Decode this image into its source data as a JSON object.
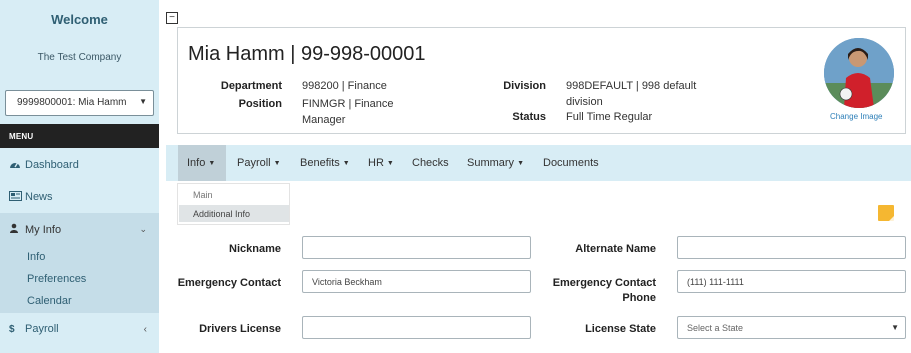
{
  "sidebar": {
    "welcome": "Welcome",
    "company": "The Test Company",
    "employee_select": "9999800001: Mia Hamm",
    "menu_heading": "MENU",
    "nav": {
      "dashboard": "Dashboard",
      "news": "News",
      "my_info": "My Info",
      "payroll": "Payroll"
    },
    "my_info_sub": [
      "Info",
      "Preferences",
      "Calendar"
    ]
  },
  "header": {
    "collapse_symbol": "−",
    "employee_title": "Mia Hamm | 99-998-00001",
    "department_label": "Department",
    "department_value": "998200 | Finance",
    "position_label": "Position",
    "position_value": "FINMGR | Finance Manager",
    "division_label": "Division",
    "division_value": "998DEFAULT | 998 default division",
    "status_label": "Status",
    "status_value": "Full Time Regular",
    "change_image": "Change Image"
  },
  "tabs": [
    "Info",
    "Payroll",
    "Benefits",
    "HR",
    "Checks",
    "Summary",
    "Documents"
  ],
  "info_dropdown": {
    "main": "Main",
    "additional": "Additional Info"
  },
  "form": {
    "nickname_label": "Nickname",
    "nickname_value": "",
    "alt_name_label": "Alternate Name",
    "alt_name_value": "",
    "emergency_contact_label": "Emergency Contact",
    "emergency_contact_value": "Victoria Beckham",
    "emergency_phone_label": "Emergency Contact Phone",
    "emergency_phone_value": "(111) 111-1111",
    "drivers_license_label": "Drivers License",
    "drivers_license_value": "",
    "license_state_label": "License State",
    "license_state_placeholder": "Select a State"
  },
  "colors": {
    "sidebar_bg": "#d8edf5",
    "menu_bar": "#222222",
    "link": "#2d7fb8",
    "sticky_note": "#f5b731"
  }
}
